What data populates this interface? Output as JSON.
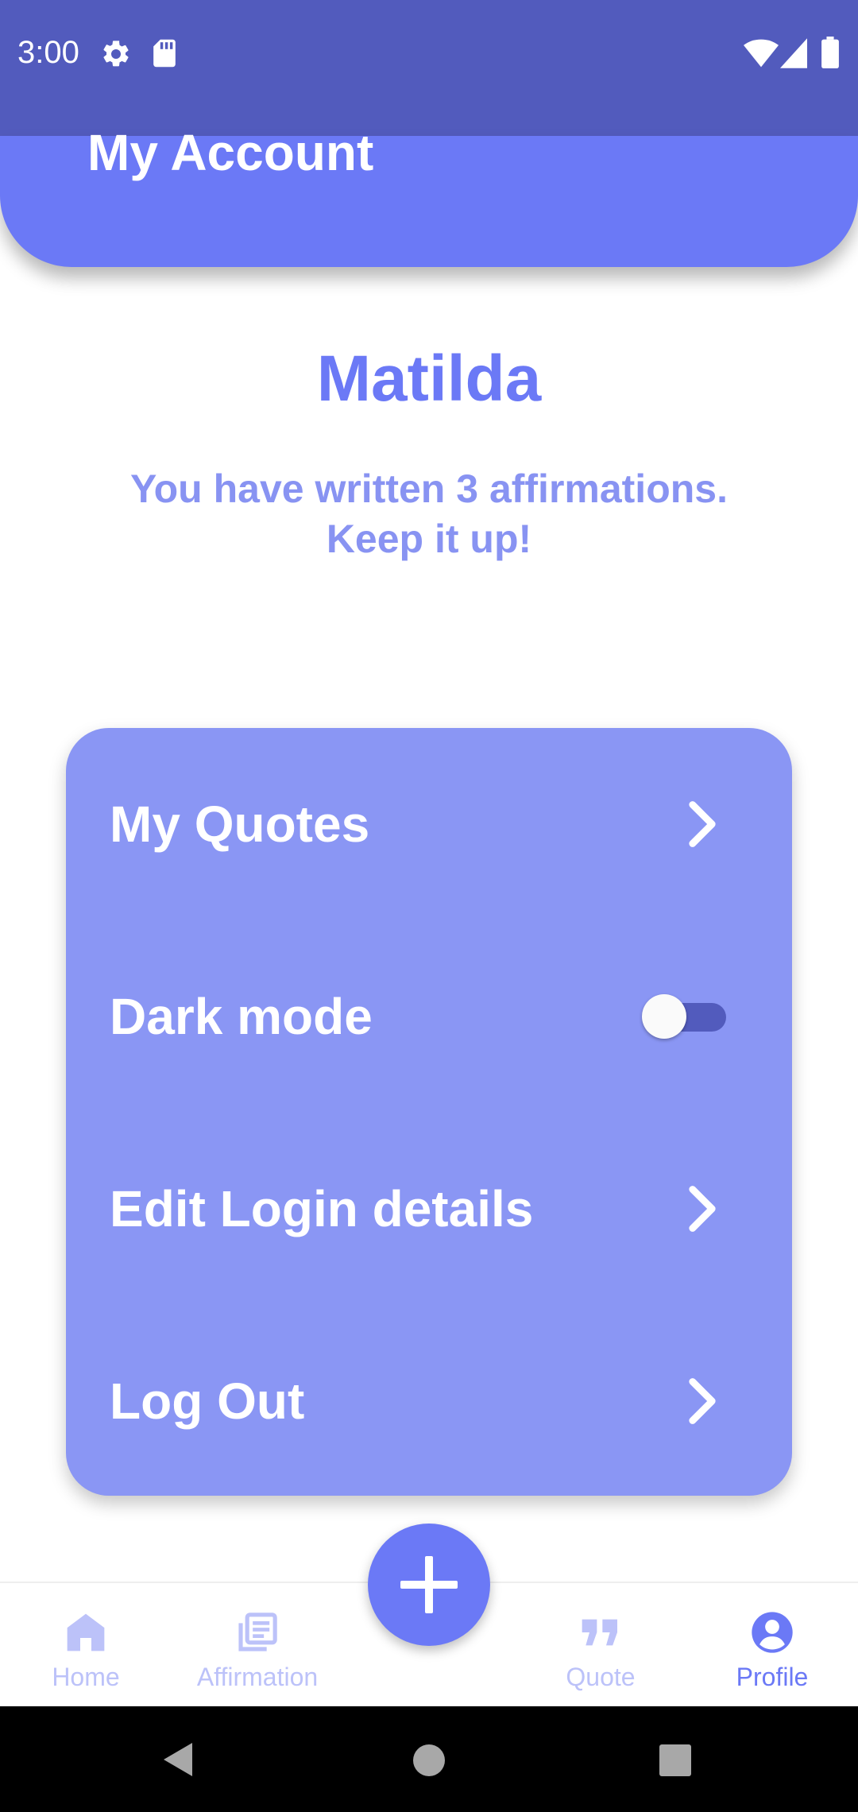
{
  "status_bar": {
    "time": "3:00",
    "left_icons": [
      "gear-icon",
      "sd-card-icon"
    ],
    "right_icons": [
      "wifi-icon",
      "signal-icon",
      "battery-icon"
    ]
  },
  "header": {
    "title": "My Account"
  },
  "profile": {
    "name": "Matilda",
    "stats_line1": "You have written 3 affirmations.",
    "stats_line2": "Keep it up!"
  },
  "menu": {
    "items": [
      {
        "label": "My Quotes",
        "control": "chevron"
      },
      {
        "label": "Dark mode",
        "control": "toggle",
        "toggle_on": false
      },
      {
        "label": "Edit Login details",
        "control": "chevron"
      },
      {
        "label": "Log Out",
        "control": "chevron"
      }
    ]
  },
  "bottom_nav": {
    "items": [
      {
        "label": "Home",
        "icon": "home-icon",
        "active": false
      },
      {
        "label": "Affirmation",
        "icon": "affirmation-icon",
        "active": false
      },
      {
        "label": "Quote",
        "icon": "quote-icon",
        "active": false
      },
      {
        "label": "Profile",
        "icon": "profile-icon",
        "active": true
      }
    ],
    "fab_icon": "plus-icon"
  },
  "colors": {
    "status_bar": "#525bbd",
    "primary": "#6b79f6",
    "card": "#8a96f4",
    "inactive_nav": "#bcc2f9",
    "stats_text": "#8893f2"
  }
}
